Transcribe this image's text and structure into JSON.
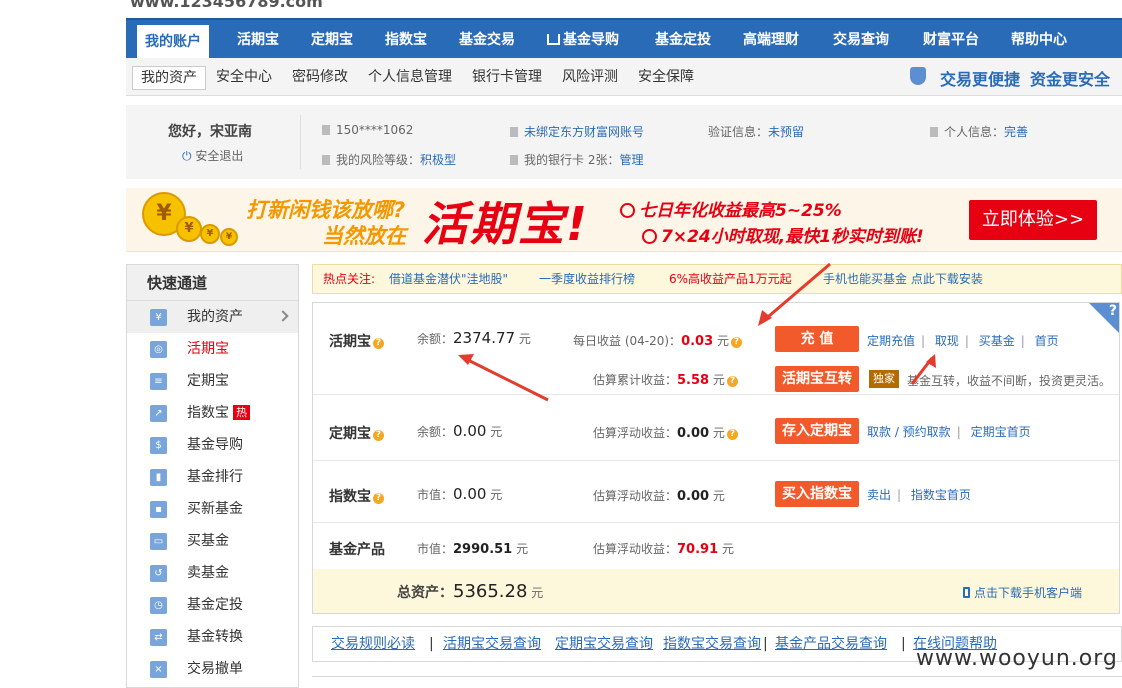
{
  "header_cut_text": "www.123456789.com",
  "nav": {
    "items": [
      {
        "label": "我的账户",
        "active": true
      },
      {
        "label": "活期宝"
      },
      {
        "label": "定期宝"
      },
      {
        "label": "指数宝"
      },
      {
        "label": "基金交易"
      },
      {
        "label": "基金导购",
        "icon": "cart-icon"
      },
      {
        "label": "基金定投"
      },
      {
        "label": "高端理财"
      },
      {
        "label": "交易查询"
      },
      {
        "label": "财富平台"
      },
      {
        "label": "帮助中心"
      }
    ]
  },
  "subnav": {
    "items": [
      "我的资产",
      "安全中心",
      "密码修改",
      "个人信息管理",
      "银行卡管理",
      "风险评测",
      "安全保障"
    ],
    "slogan1": "交易更便捷",
    "slogan2": "资金更安全"
  },
  "user": {
    "greeting": "您好，宋亚南",
    "logout": "安全退出",
    "phone": "150****1062",
    "risk_label": "我的风险等级：",
    "risk_value": "积极型",
    "account_text": "未绑定东方财富网账号",
    "bankcard_label": "我的银行卡 2张：",
    "bankcard_link": "管理",
    "verify_label": "验证信息：",
    "verify_value": "未预留",
    "profile_label": "个人信息：",
    "profile_value": "完善"
  },
  "banner": {
    "line1": "打新闲钱该放哪?",
    "line2": "当然放在",
    "big": "活期宝!",
    "feat1": "七日年化收益最高5~25%",
    "feat2": "7×24小时取现,最快1秒实时到账!",
    "button": "立即体验>>"
  },
  "sidebar": {
    "title": "快速通道",
    "items": [
      {
        "label": "我的资产",
        "icon": "wallet-icon",
        "active": true
      },
      {
        "label": "活期宝",
        "icon": "piggy-icon",
        "red": true
      },
      {
        "label": "定期宝",
        "icon": "deposit-icon"
      },
      {
        "label": "指数宝",
        "icon": "index-icon",
        "badge": "热"
      },
      {
        "label": "基金导购",
        "icon": "guide-icon"
      },
      {
        "label": "基金排行",
        "icon": "bar-chart-icon"
      },
      {
        "label": "买新基金",
        "icon": "new-fund-icon"
      },
      {
        "label": "买基金",
        "icon": "cart-icon"
      },
      {
        "label": "卖基金",
        "icon": "sell-icon"
      },
      {
        "label": "基金定投",
        "icon": "clock-icon"
      },
      {
        "label": "基金转换",
        "icon": "convert-icon"
      },
      {
        "label": "交易撤单",
        "icon": "cancel-icon"
      }
    ]
  },
  "hotbar": {
    "label": "热点关注:",
    "items": [
      "借道基金潜伏\"洼地股\"",
      "一季度收益排行榜",
      "6%高收益产品1万元起",
      "手机也能买基金 点此下载安装"
    ]
  },
  "products": {
    "hqb": {
      "name": "活期宝",
      "balance_label": "余额：",
      "balance": "2374.77",
      "unit": "元",
      "daily_label": "每日收益 (04-20)：",
      "daily": "0.03",
      "cum_label": "估算累计收益：",
      "cum": "5.58",
      "btn_charge": "充  值",
      "btn_swap": "活期宝互转",
      "links": [
        "定期充值",
        "取现",
        "买基金",
        "首页"
      ],
      "exclusive": "独家",
      "swap_desc": "基金互转，收益不间断，投资更灵活。"
    },
    "dqb": {
      "name": "定期宝",
      "balance_label": "余额：",
      "balance": "0.00",
      "unit": "元",
      "float_label": "估算浮动收益：",
      "float": "0.00",
      "btn": "存入定期宝",
      "links": [
        "取款 / 预约取款",
        "定期宝首页"
      ]
    },
    "zsb": {
      "name": "指数宝",
      "value_label": "市值：",
      "value": "0.00",
      "unit": "元",
      "float_label": "估算浮动收益：",
      "float": "0.00",
      "btn": "买入指数宝",
      "links": [
        "卖出",
        "指数宝首页"
      ]
    },
    "fund": {
      "name": "基金产品",
      "value_label": "市值：",
      "value": "2990.51",
      "unit": "元",
      "float_label": "估算浮动收益：",
      "float": "70.91"
    },
    "total_label": "总资产：",
    "total": "5365.28",
    "total_unit": "元",
    "download": "点击下载手机客户端"
  },
  "bottom_links": [
    "交易规则必读",
    "活期宝交易查询",
    "定期宝交易查询",
    "指数宝交易查询",
    "基金产品交易查询",
    "在线问题帮助"
  ],
  "watermark": "www.wooyun.org",
  "colors": {
    "nav_blue": "#2a6bb8",
    "accent_red": "#e60012",
    "button_orange": "#f25a2c",
    "banner_orange": "#f39800"
  }
}
